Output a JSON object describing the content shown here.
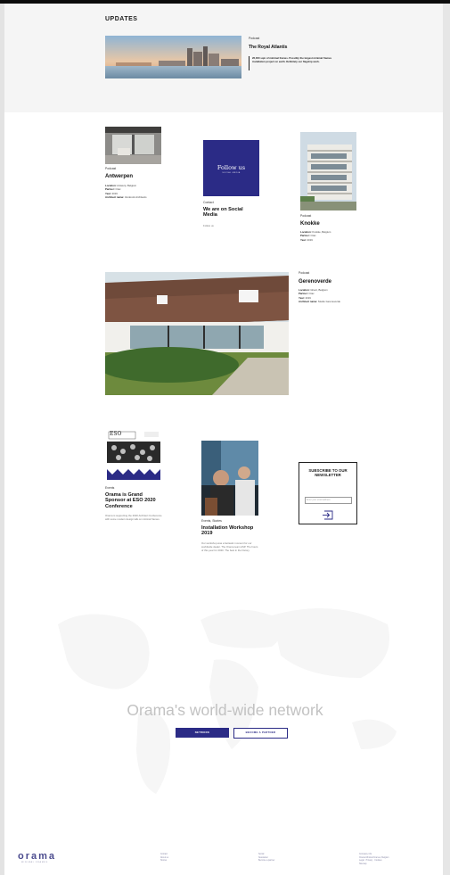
{
  "updates": {
    "heading": "UPDATES",
    "featured": {
      "tag": "Podcast",
      "title": "The Royal Atlantis",
      "description": "26,000 sqm of minimal frames. Possibly the largest minimal frames installation project on earth. Definitely our flagship work."
    }
  },
  "grid_row1": [
    {
      "tag": "Podcast",
      "title": "Antwerpen",
      "location_label": "Location:",
      "location_value": "Antwerp, Belgium",
      "partner_label": "Partner:",
      "partner_value": "Orac",
      "year_label": "Year:",
      "year_value": "2019",
      "architect_label": "Architect name:",
      "architect_value": "Verdonck Architects"
    },
    {
      "card_title": "Follow us",
      "card_subtitle": "SOCIAL MEDIA",
      "tag": "Contact",
      "title": "We are on Social Media",
      "sub": "Follow us"
    },
    {
      "tag": "Podcast",
      "title": "Knokke",
      "location_label": "Location:",
      "location_value": "Knokke, Belgium",
      "partner_label": "Partner:",
      "partner_value": "Orac",
      "year_label": "Year:",
      "year_value": "2019"
    }
  ],
  "grid_row2": {
    "tag": "Podcast",
    "title": "Gerenoverde",
    "location_label": "Location:",
    "location_value": "Ghent, Belgium",
    "partner_label": "Partner:",
    "partner_value": "Orac",
    "year_label": "Year:",
    "year_value": "2019",
    "architect_label": "Architect name:",
    "architect_value": "Studio Gerenoverde"
  },
  "grid_row3": [
    {
      "poster_title": "ESO",
      "tag": "Events",
      "title": "Orama is Grand Sponsor at ESO 2020 Conference",
      "description": "Orama is supporting the 2020 Architect Conference with some modern design talk on minimal frames."
    },
    {
      "tag": "Events, Stories",
      "title": "Installation Workshop 2019",
      "description": "Our workshop was a fantastic moment for our worldwide dealer. The Orama team ASP. The hours of this year for 2020. The best in the history."
    }
  ],
  "newsletter": {
    "title": "SUBSCRIBE TO OUR NEWSLETTER",
    "placeholder": "Enter your email address",
    "submit_icon": "arrow-into-box-icon"
  },
  "network": {
    "heading": "Orama's world-wide network",
    "network_button": "NETWORK",
    "partner_button": "BECOME A PARTNER"
  },
  "footer": {
    "logo": "orama",
    "logo_sub": "MINIMAL FRAMES",
    "col1": [
      "Contact",
      "About us",
      "Stories"
    ],
    "col2": [
      "Social",
      "Newsletter",
      "Become a partner"
    ],
    "col3": [
      "Company info",
      "Orama Minimal Frames, Belgium",
      "Legal · Privacy · Cookies",
      "Sitemap"
    ]
  },
  "colors": {
    "brand": "#2b2b86",
    "band": "#f5f5f5"
  }
}
